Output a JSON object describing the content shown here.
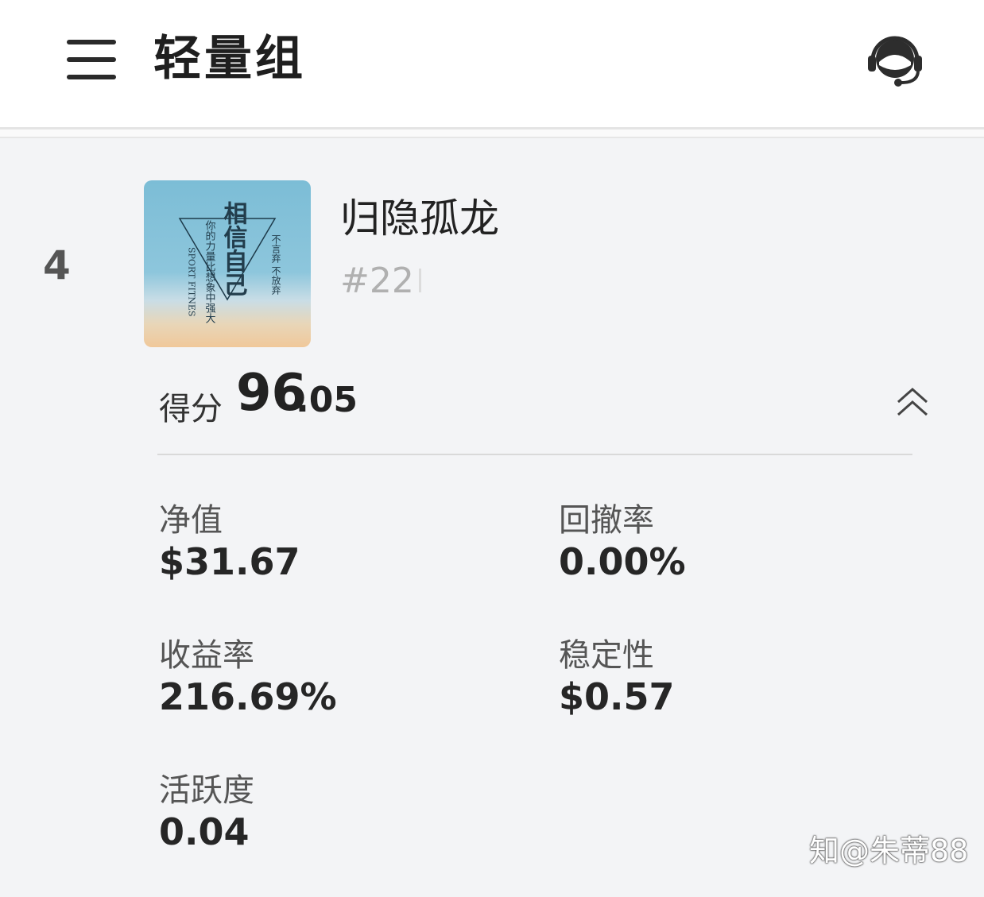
{
  "header": {
    "title": "轻量组",
    "menu_icon": "hamburger-menu-icon",
    "support_icon": "customer-service-headset-icon"
  },
  "entry": {
    "rank": "4",
    "name": "归隐孤龙",
    "id": "#22",
    "avatar": {
      "title": "相信自己",
      "line1": "不言弃 不放弃",
      "line2": "你的力量比想象中强大",
      "line3": "SPORT FITNES"
    },
    "score_label": "得分",
    "score_int": "96",
    "score_dec": ".05",
    "collapse_icon": "chevron-up-double-icon"
  },
  "stats": {
    "net_value": {
      "label": "净值",
      "value": "$31.67"
    },
    "drawdown": {
      "label": "回撤率",
      "value": "0.00%"
    },
    "return_rate": {
      "label": "收益率",
      "value": "216.69%"
    },
    "stability": {
      "label": "稳定性",
      "value": "$0.57"
    },
    "activity": {
      "label": "活跃度",
      "value": "0.04"
    }
  },
  "watermark": "知@朱蒂88",
  "colors": {
    "background": "#f3f4f6",
    "header_bg": "#ffffff",
    "id_gray": "#b0b0b0"
  }
}
